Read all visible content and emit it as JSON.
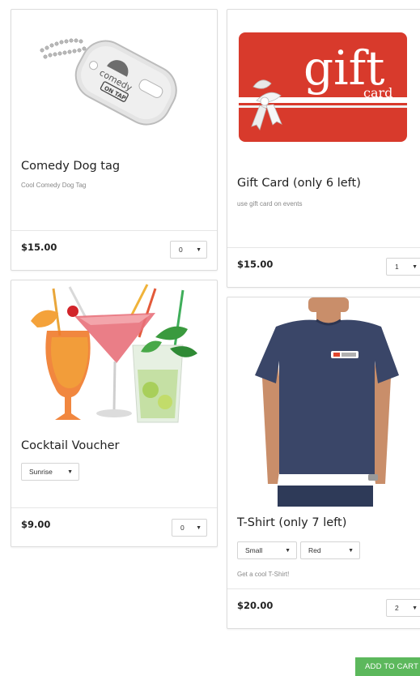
{
  "products": [
    {
      "image_name": "dog-tag-image",
      "title": "Comedy Dog tag",
      "description": "Cool Comedy Dog Tag",
      "price": "$15.00",
      "quantity": "0"
    },
    {
      "image_name": "gift-card-image",
      "image_text_main": "gift",
      "image_text_sub": "card",
      "title": "Gift Card (only 6 left)",
      "description": "use gift card on events",
      "price": "$15.00",
      "quantity": "1"
    },
    {
      "image_name": "cocktails-image",
      "title": "Cocktail Voucher",
      "option_selected": "Sunrise",
      "price": "$9.00",
      "quantity": "0"
    },
    {
      "image_name": "tshirt-image",
      "title": "T-Shirt (only 7 left)",
      "size_selected": "Small",
      "color_selected": "Red",
      "description": "Get a cool T-Shirt!",
      "price": "$20.00",
      "quantity": "2"
    }
  ],
  "dog_tag_engraving": [
    "comedy",
    "ON TAP"
  ],
  "add_to_cart_label": "ADD TO CART",
  "colors": {
    "accent_green": "#5cb85c",
    "gift_red": "#d83a2c",
    "shirt_navy": "#3a4668"
  }
}
